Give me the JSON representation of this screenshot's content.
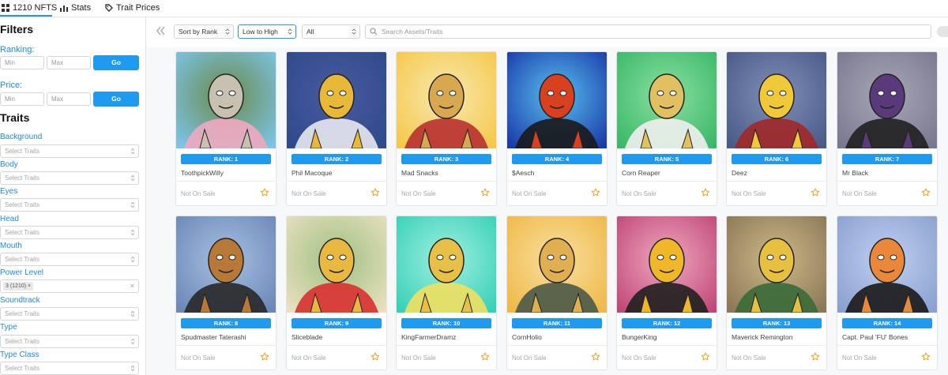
{
  "tabs": [
    {
      "label": "1210 NFTS",
      "icon": "grid-icon",
      "active": true
    },
    {
      "label": "Stats",
      "icon": "bar-chart-icon",
      "active": false
    },
    {
      "label": "Trait Prices",
      "icon": "tag-icon",
      "active": false
    }
  ],
  "accent_color": "#1e9bf0",
  "sidebar": {
    "filters_title": "Filters",
    "ranking": {
      "label": "Ranking:",
      "min_placeholder": "Min",
      "max_placeholder": "Max",
      "go_label": "Go"
    },
    "price": {
      "label": "Price:",
      "min_placeholder": "Min",
      "max_placeholder": "Max",
      "go_label": "Go"
    },
    "traits_title": "Traits",
    "traits": [
      {
        "label": "Background",
        "placeholder": "Select Traits"
      },
      {
        "label": "Body",
        "placeholder": "Select Traits"
      },
      {
        "label": "Eyes",
        "placeholder": "Select Traits"
      },
      {
        "label": "Head",
        "placeholder": "Select Traits"
      },
      {
        "label": "Mouth",
        "placeholder": "Select Traits"
      },
      {
        "label": "Power Level",
        "placeholder": "",
        "chip": "3 (1210)",
        "chip_remove": "×",
        "clear": "×"
      },
      {
        "label": "Soundtrack",
        "placeholder": "Select Traits"
      },
      {
        "label": "Type",
        "placeholder": "Select Traits"
      },
      {
        "label": "Type Class",
        "placeholder": "Select Traits"
      }
    ]
  },
  "toolbar": {
    "sort_by": "Sort by Rank",
    "order": "Low to High",
    "filter": "All",
    "search_placeholder": "Search Assets/Traits"
  },
  "cards": [
    {
      "rank": "RANK: 1",
      "name": "ToothpickWilly",
      "status": "Not On Sale"
    },
    {
      "rank": "RANK: 2",
      "name": "Phil Macoque",
      "status": "Not On Sale"
    },
    {
      "rank": "RANK: 3",
      "name": "Mad Snacks",
      "status": "Not On Sale"
    },
    {
      "rank": "RANK: 4",
      "name": "$Aesch",
      "status": "Not On Sale"
    },
    {
      "rank": "RANK: 5",
      "name": "Corn Reaper",
      "status": "Not On Sale"
    },
    {
      "rank": "RANK: 6",
      "name": "Deez",
      "status": "Not On Sale"
    },
    {
      "rank": "RANK: 7",
      "name": "Mr Black",
      "status": "Not On Sale"
    },
    {
      "rank": "RANK: 8",
      "name": "Spudmaster Taterashi",
      "status": "Not On Sale"
    },
    {
      "rank": "RANK: 9",
      "name": "Sliceblade",
      "status": "Not On Sale"
    },
    {
      "rank": "RANK: 10",
      "name": "KingFarmerDramz",
      "status": "Not On Sale"
    },
    {
      "rank": "RANK: 11",
      "name": "CornHolio",
      "status": "Not On Sale"
    },
    {
      "rank": "RANK: 12",
      "name": "BungerKing",
      "status": "Not On Sale"
    },
    {
      "rank": "RANK: 13",
      "name": "Maverick Remington",
      "status": "Not On Sale"
    },
    {
      "rank": "RANK: 14",
      "name": "Capt. Paul 'FU' Bones",
      "status": "Not On Sale"
    }
  ],
  "card_art": [
    {
      "bg": "#7cc4e8",
      "bg2": "#6a8a4a",
      "char": "#c8c0b0",
      "accent": "#f0a8c0"
    },
    {
      "bg": "#2e4a8a",
      "bg2": "#4a5aa0",
      "char": "#e8b838",
      "accent": "#e8e8f0"
    },
    {
      "bg": "#f5c84a",
      "bg2": "#f8e8b0",
      "char": "#d8a850",
      "accent": "#b83030"
    },
    {
      "bg": "#1a3aa8",
      "bg2": "#58c0f0",
      "char": "#d84020",
      "accent": "#1a1a1a"
    },
    {
      "bg": "#3ab868",
      "bg2": "#8ae0a0",
      "char": "#e0c060",
      "accent": "#f0f0f0"
    },
    {
      "bg": "#4a5a88",
      "bg2": "#8090b8",
      "char": "#f0c838",
      "accent": "#a02828"
    },
    {
      "bg": "#7a7890",
      "bg2": "#a8a8b8",
      "char": "#5a3a7a",
      "accent": "#202020"
    },
    {
      "bg": "#6a88b8",
      "bg2": "#a8c0e0",
      "char": "#b87838",
      "accent": "#282828"
    },
    {
      "bg": "#e8e0c0",
      "bg2": "#a0c080",
      "char": "#e8b840",
      "accent": "#d83030"
    },
    {
      "bg": "#38d0b8",
      "bg2": "#a0f0e0",
      "char": "#e8c048",
      "accent": "#f0e060"
    },
    {
      "bg": "#f0b848",
      "bg2": "#f8e0a0",
      "char": "#e0b050",
      "accent": "#4a5a48"
    },
    {
      "bg": "#c04878",
      "bg2": "#f0a8c0",
      "char": "#f0b828",
      "accent": "#202020"
    },
    {
      "bg": "#8a7858",
      "bg2": "#d0b888",
      "char": "#e8c040",
      "accent": "#3a6a38"
    },
    {
      "bg": "#8aa0d0",
      "bg2": "#c0d0f0",
      "char": "#e88838",
      "accent": "#1a1a1a"
    }
  ]
}
